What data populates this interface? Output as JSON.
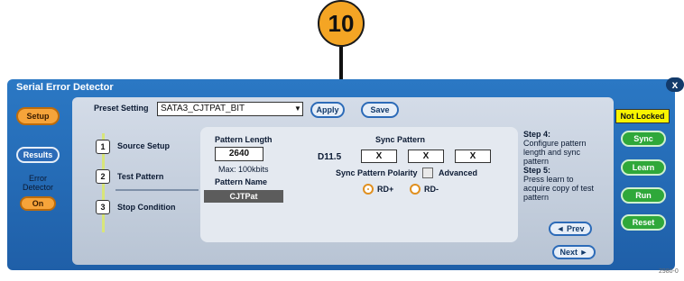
{
  "callout": {
    "number": "10"
  },
  "window": {
    "title": "Serial Error Detector",
    "close_label": "x"
  },
  "left": {
    "setup_label": "Setup",
    "results_label": "Results",
    "error_detector_label": "Error Detector",
    "error_detector_value": "On"
  },
  "preset": {
    "label": "Preset Setting",
    "value": "SATA3_CJTPAT_BIT",
    "dropdown_glyph": "▼",
    "apply_label": "Apply",
    "save_label": "Save"
  },
  "steps": [
    {
      "num": "1",
      "label": "Source Setup"
    },
    {
      "num": "2",
      "label": "Test Pattern"
    },
    {
      "num": "3",
      "label": "Stop Condition"
    }
  ],
  "pattern": {
    "length_label": "Pattern Length",
    "length_value": "2640",
    "max_label": "Max: 100kbits",
    "name_label": "Pattern Name",
    "name_value": "CJTPat"
  },
  "sync": {
    "title": "Sync Pattern",
    "d_value": "D11.5",
    "fields": [
      "X",
      "X",
      "X"
    ],
    "polarity_label": "Sync Pattern Polarity",
    "advanced_label": "Advanced",
    "rd_plus": "RD+",
    "rd_minus": "RD-"
  },
  "instructions": {
    "step4_title": "Step 4:",
    "step4_text": "Configure pattern length and sync pattern",
    "step5_title": "Step 5:",
    "step5_text": "Press learn to acquire copy of test pattern"
  },
  "nav": {
    "prev_label": "◄ Prev",
    "next_label": "Next ►"
  },
  "right": {
    "status": "Not Locked",
    "sync_label": "Sync",
    "learn_label": "Learn",
    "run_label": "Run",
    "reset_label": "Reset"
  },
  "figure_id": "2980-0"
}
